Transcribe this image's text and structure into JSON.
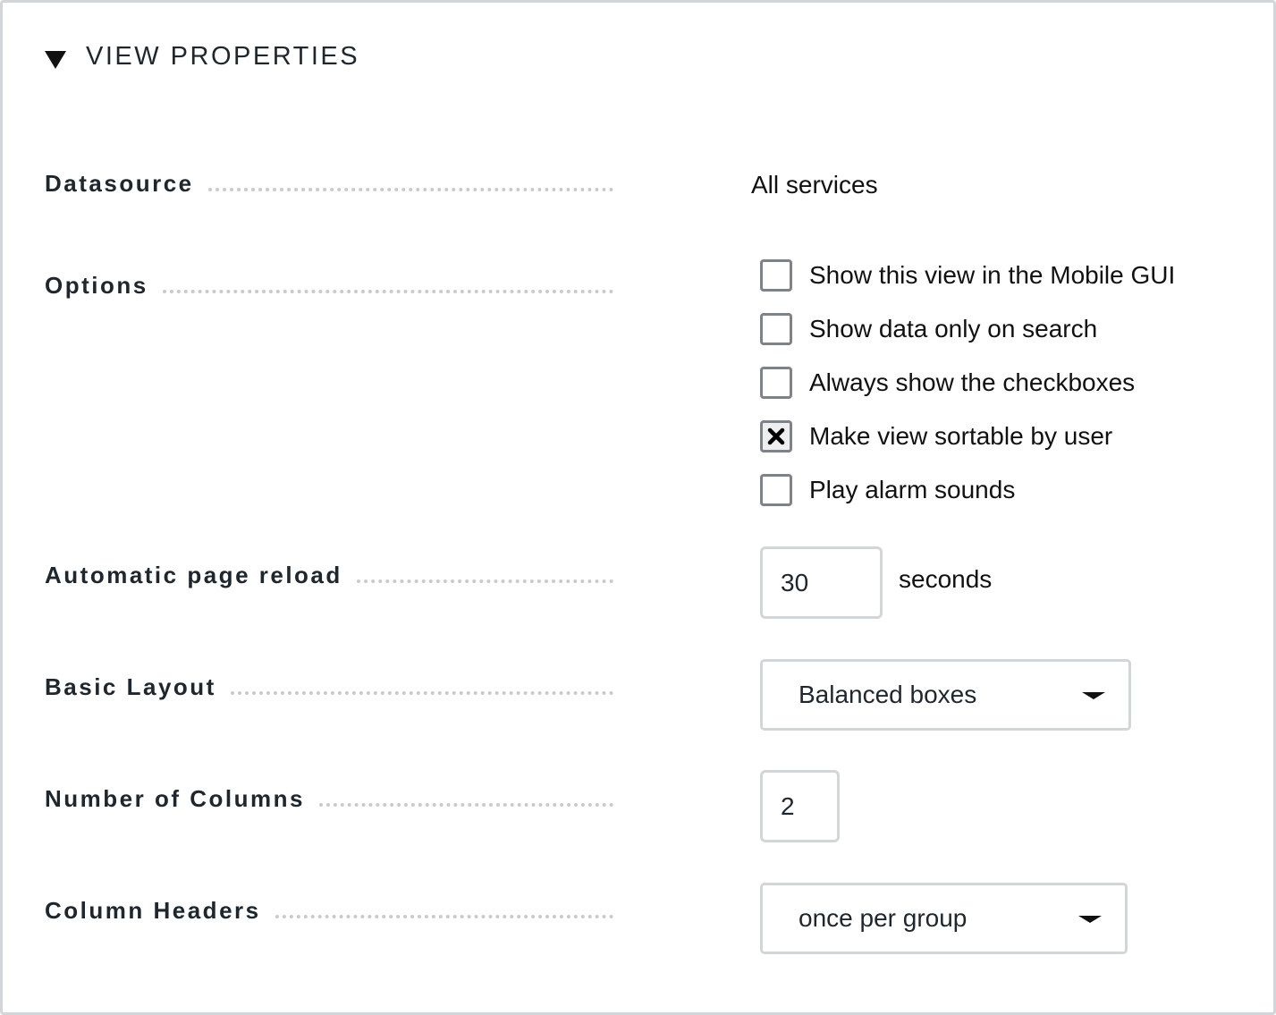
{
  "section": {
    "title": "VIEW PROPERTIES",
    "toggle_icon": "triangle-down-icon"
  },
  "datasource": {
    "label": "Datasource",
    "value": "All services"
  },
  "options": {
    "label": "Options",
    "items": [
      {
        "label": "Show this view in the Mobile GUI",
        "checked": false
      },
      {
        "label": "Show data only on search",
        "checked": false
      },
      {
        "label": "Always show the checkboxes",
        "checked": false
      },
      {
        "label": "Make view sortable by user",
        "checked": true
      },
      {
        "label": "Play alarm sounds",
        "checked": false
      }
    ]
  },
  "reload": {
    "label": "Automatic page reload",
    "value": "30",
    "unit": "seconds"
  },
  "layout": {
    "label": "Basic Layout",
    "selected": "Balanced boxes"
  },
  "columns": {
    "label": "Number of Columns",
    "value": "2"
  },
  "headers": {
    "label": "Column Headers",
    "selected": "once per group"
  },
  "colors": {
    "text": "#1e262e",
    "border": "#d3d6d9",
    "checkbox_border": "#7e8389",
    "dots": "#c8cbce"
  }
}
